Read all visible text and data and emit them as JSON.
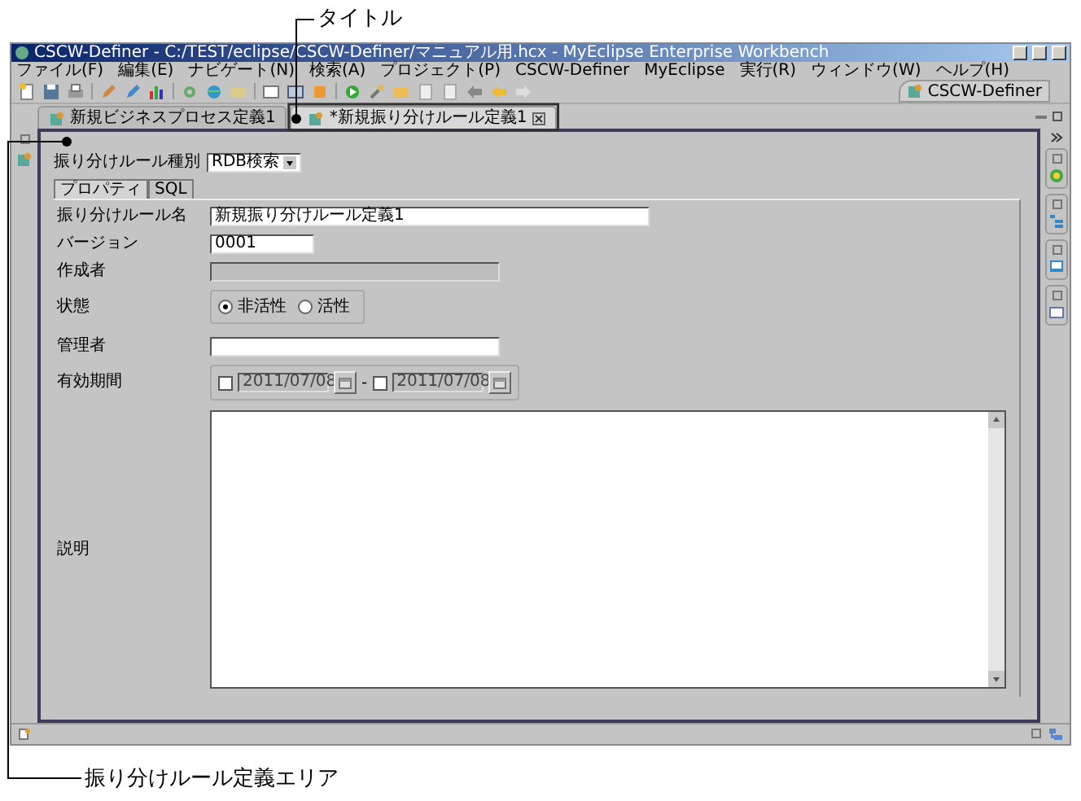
{
  "window": {
    "title": "CSCW-Definer - C:/TEST/eclipse/CSCW-Definer/マニュアル用.hcx - MyEclipse Enterprise Workbench"
  },
  "menu": [
    "ファイル(F)",
    "編集(E)",
    "ナビゲート(N)",
    "検索(A)",
    "プロジェクト(P)",
    "CSCW-Definer",
    "MyEclipse",
    "実行(R)",
    "ウィンドウ(W)",
    "ヘルプ(H)"
  ],
  "perspective": {
    "label": "CSCW-Definer"
  },
  "editor_tabs": [
    {
      "label": "新規ビジネスプロセス定義1",
      "selected": false
    },
    {
      "label": "*新規振り分けルール定義1",
      "selected": true
    }
  ],
  "form": {
    "type_label": "振り分けルール種別",
    "type_value": "RDB検索",
    "sub_tabs": [
      {
        "label": "プロパティ",
        "selected": true
      },
      {
        "label": "SQL",
        "selected": false
      }
    ],
    "rows": [
      {
        "kind": "text",
        "label": "振り分けルール名",
        "value": "新規振り分けルール定義1",
        "disabled": false
      },
      {
        "kind": "text",
        "label": "バージョン",
        "value": "0001",
        "disabled": false
      },
      {
        "kind": "text",
        "label": "作成者",
        "disabled": true
      },
      {
        "kind": "radio",
        "label": "状態",
        "options": [
          {
            "label": "非活性",
            "selected": true
          },
          {
            "label": "活性",
            "selected": false
          }
        ]
      },
      {
        "kind": "text",
        "label": "管理者",
        "disabled": false
      },
      {
        "kind": "daterange",
        "label": "有効期間",
        "from": {
          "checked": false,
          "value": "2011/07/08",
          "disabled": true
        },
        "separator": "-",
        "to": {
          "checked": false,
          "value": "2011/07/08",
          "disabled": true
        }
      },
      {
        "kind": "textarea",
        "label": "説明"
      }
    ]
  },
  "annotations": [
    {
      "kind": "title",
      "label": "タイトル"
    },
    {
      "kind": "area",
      "label": "振り分けルール定義エリア"
    }
  ]
}
